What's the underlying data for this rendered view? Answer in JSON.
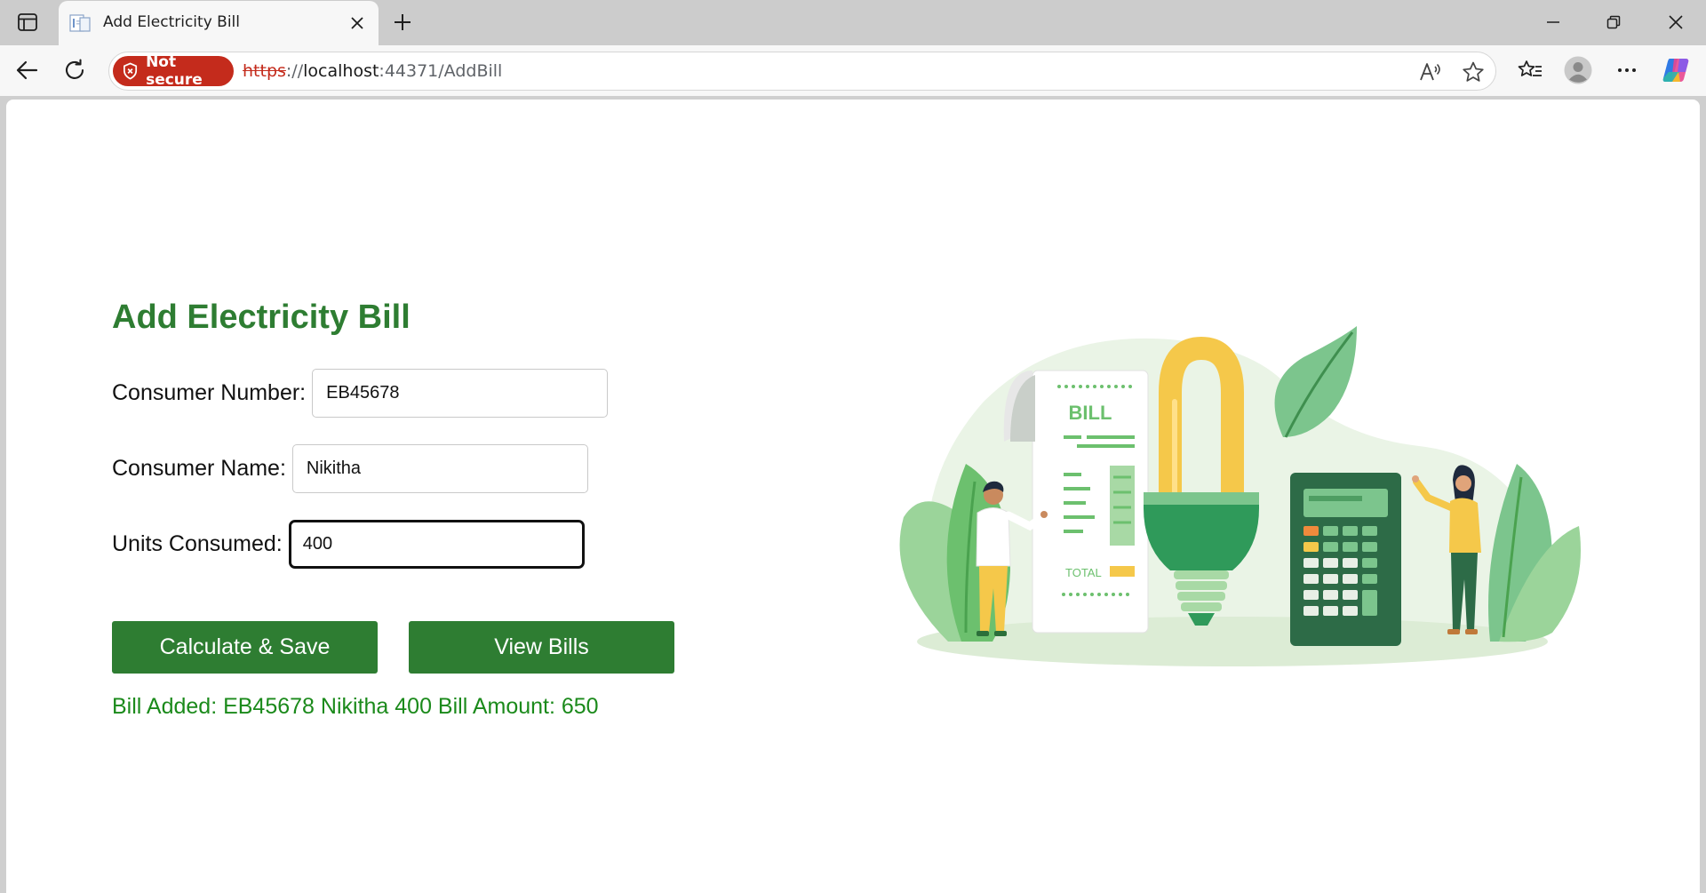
{
  "browser": {
    "tab": {
      "title": "Add Electricity Bill"
    },
    "address": {
      "security_label": "Not secure",
      "url_protocol": "https",
      "url_separator": "://",
      "url_host": "localhost",
      "url_rest": ":44371/AddBill"
    }
  },
  "page": {
    "title": "Add Electricity Bill",
    "fields": [
      {
        "label": "Consumer Number:",
        "value": "EB45678"
      },
      {
        "label": "Consumer Name:",
        "value": "Nikitha"
      },
      {
        "label": "Units Consumed:",
        "value": "400"
      }
    ],
    "buttons": {
      "calculate_label": "Calculate & Save",
      "view_label": "View Bills"
    },
    "result_message": "Bill Added: EB45678 Nikitha 400 Bill Amount: 650",
    "illustration": {
      "receipt_title": "BILL",
      "receipt_total": "TOTAL"
    }
  },
  "colors": {
    "accent": "#2e7d32",
    "result_text": "#1b8a1b",
    "not_secure": "#c42b1c"
  }
}
